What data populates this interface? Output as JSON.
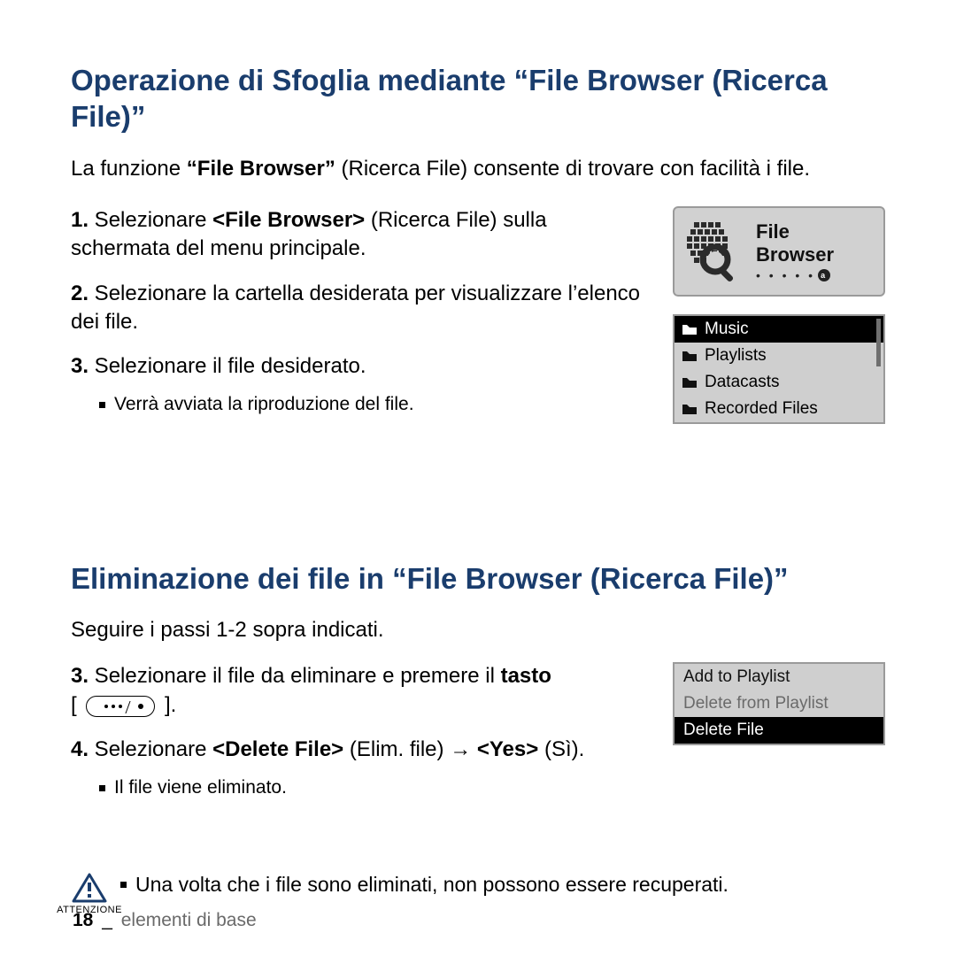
{
  "section1": {
    "title": "Operazione di Sfoglia mediante “File Browser (Ricerca File)”",
    "intro_pre": "La funzione ",
    "intro_bold": "“File Browser”",
    "intro_post": " (Ricerca File) consente di trovare con facilità i file.",
    "step1_num": "1.",
    "step1_pre": " Selezionare ",
    "step1_bold": "<File Browser>",
    "step1_post": " (Ricerca File) sulla schermata del menu principale.",
    "step2_num": "2.",
    "step2_text": " Selezionare la cartella desiderata per visualizzare l’elenco dei file.",
    "step3_num": "3.",
    "step3_text": " Selezionare il file desiderato.",
    "step3_bullet": "Verrà avviata la riproduzione del file."
  },
  "fb_card": {
    "title": "File Browser",
    "dots": "• • • • •",
    "badge": "a"
  },
  "folders": {
    "items": [
      {
        "label": "Music",
        "selected": true
      },
      {
        "label": "Playlists",
        "selected": false
      },
      {
        "label": "Datacasts",
        "selected": false
      },
      {
        "label": "Recorded Files",
        "selected": false
      }
    ]
  },
  "section2": {
    "title": "Eliminazione dei file in “File Browser (Ricerca File)”",
    "intro": "Seguire i passi 1‑2 sopra indicati.",
    "step3_num": "3.",
    "step3_pre": " Selezionare il file da eliminare e premere il ",
    "step3_bold": "tasto",
    "step3_open": "[ ",
    "step3_close": " ].",
    "step4_num": "4.",
    "step4_pre": " Selezionare ",
    "step4_bold1": "<Delete File>",
    "step4_mid": " (Elim. file) → ",
    "step4_bold2": "<Yes>",
    "step4_post": " (Sì).",
    "step4_bullet": "Il file viene eliminato."
  },
  "ctx": {
    "items": [
      {
        "label": "Add to Playlist",
        "state": "normal"
      },
      {
        "label": "Delete from Playlist",
        "state": "dim"
      },
      {
        "label": "Delete File",
        "state": "selected"
      }
    ]
  },
  "warning": {
    "label": "ATTENZIONE",
    "text": "Una volta che i file sono eliminati, non possono essere recuperati."
  },
  "footer": {
    "page": "18",
    "separator": "_",
    "section": "elementi di base"
  }
}
